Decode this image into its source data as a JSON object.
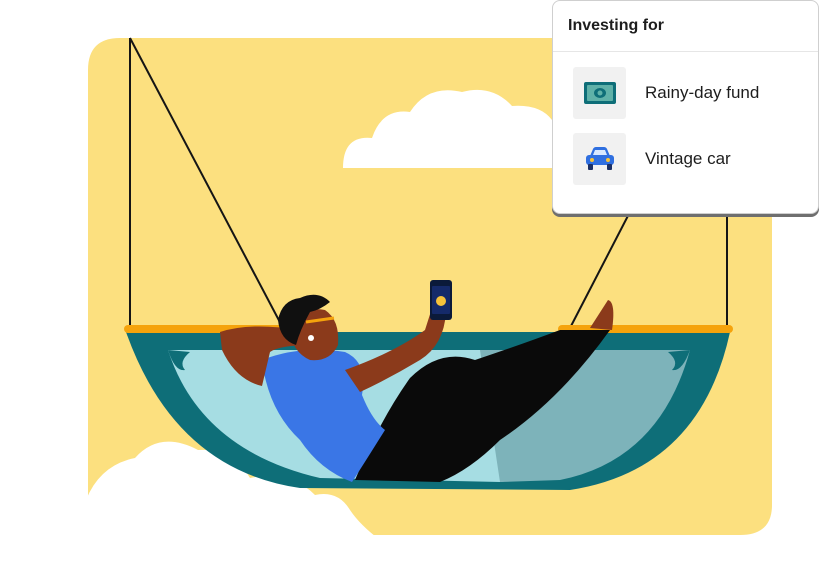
{
  "card": {
    "title": "Investing for",
    "goals": [
      {
        "label": "Rainy-day fund",
        "icon": "cash-icon"
      },
      {
        "label": "Vintage car",
        "icon": "car-icon"
      }
    ]
  },
  "colors": {
    "background_panel": "#FCE07F",
    "hammock_dark": "#0E6E78",
    "hammock_light": "#A6DDE3",
    "hammock_bar": "#F5A30C",
    "shirt": "#3A76E6",
    "skin": "#8B3A1B",
    "pants": "#0A0A0A"
  }
}
